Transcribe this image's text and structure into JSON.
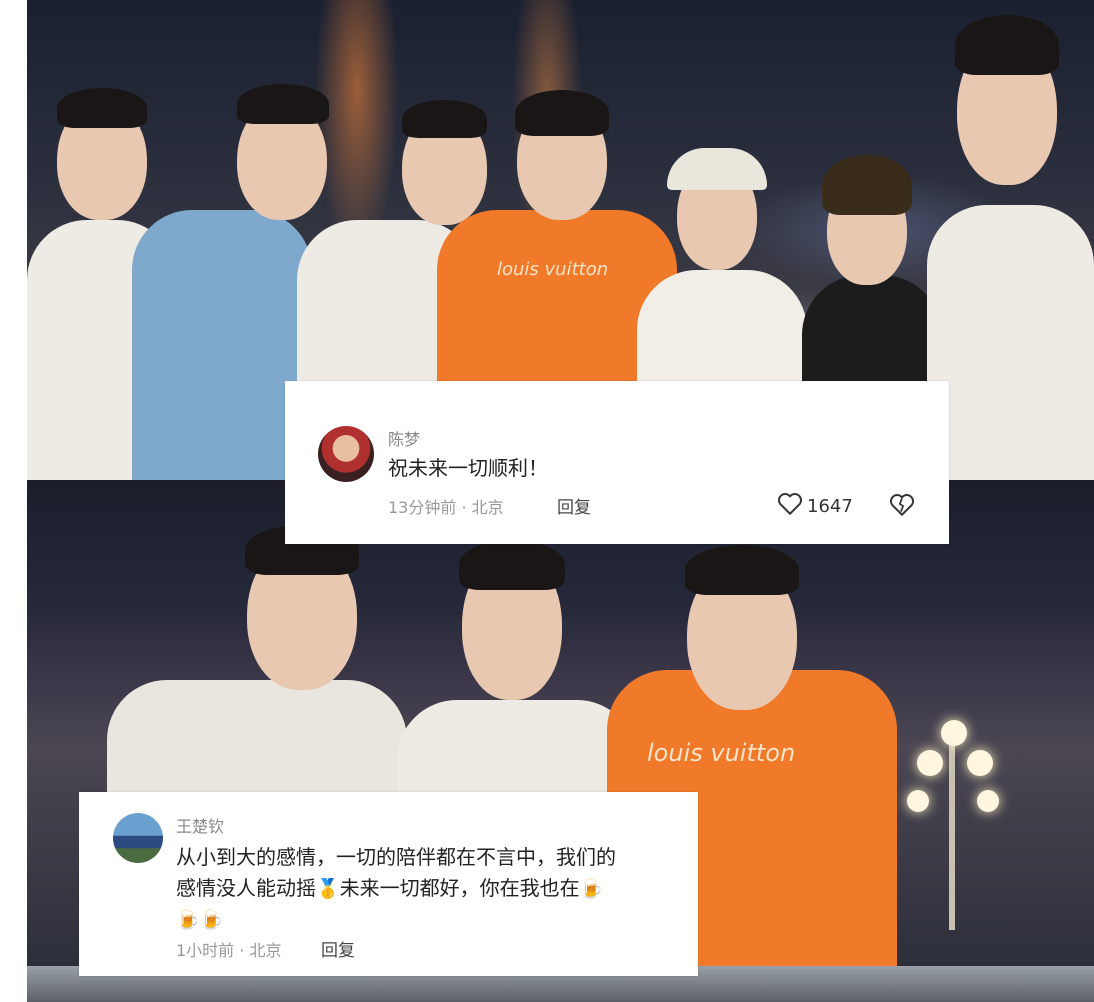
{
  "comment1": {
    "name": "陈梦",
    "text": "祝未来一切顺利！",
    "time": "13分钟前 · 北京",
    "reply": "回复",
    "likes": "1647"
  },
  "comment2": {
    "name": "王楚钦",
    "line1": "从小到大的感情，一切的陪伴都在不言中，我们的",
    "line2a": "感情没人能动摇",
    "line2b": "未来一切都好，你在我也在",
    "time": "1小时前 · 北京",
    "reply": "回复"
  },
  "shirt_print": "louis vuitton",
  "colors": {
    "orange_shirt": "#f07a2a",
    "white_shirt": "#eeeae4",
    "blue_shirt": "#7ea8cc",
    "black_shirt": "#1c1c1c"
  }
}
